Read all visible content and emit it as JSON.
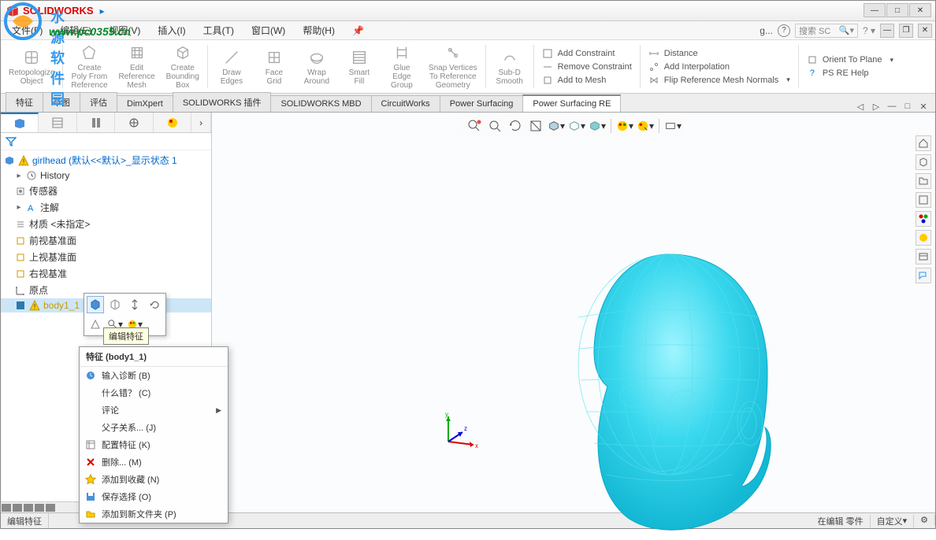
{
  "app_name": "SOLIDWORKS",
  "watermark_url": "www.pc0359.cn",
  "watermark_text": "水源软件园",
  "menus": [
    "文件(F)",
    "编辑(E)",
    "视图(V)",
    "插入(I)",
    "工具(T)",
    "窗口(W)",
    "帮助(H)"
  ],
  "search_letter": "g...",
  "search_placeholder": "搜索 SC",
  "ribbon": {
    "btns": [
      {
        "l1": "Retopologize",
        "l2": "Object"
      },
      {
        "l1": "Create",
        "l2": "Poly From",
        "l3": "Reference"
      },
      {
        "l1": "Edit",
        "l2": "Reference",
        "l3": "Mesh"
      },
      {
        "l1": "Create",
        "l2": "Bounding",
        "l3": "Box"
      },
      {
        "l1": "Draw",
        "l2": "Edges"
      },
      {
        "l1": "Face",
        "l2": "Grid"
      },
      {
        "l1": "Wrap",
        "l2": "Around"
      },
      {
        "l1": "Smart",
        "l2": "Fill"
      },
      {
        "l1": "Glue",
        "l2": "Edge",
        "l3": "Group"
      },
      {
        "l1": "Snap Vertices",
        "l2": "To Reference",
        "l3": "Geometry"
      },
      {
        "l1": "Sub-D",
        "l2": "Smooth"
      }
    ],
    "col1": [
      "Add Constraint",
      "Remove Constraint",
      "Add to Mesh"
    ],
    "col2": [
      "Distance",
      "Add Interpolation",
      "Flip Reference Mesh Normals"
    ],
    "col3": [
      "Orient To Plane",
      "PS RE Help"
    ]
  },
  "tabs": [
    "特征",
    "草图",
    "评估",
    "DimXpert",
    "SOLIDWORKS 插件",
    "SOLIDWORKS MBD",
    "CircuitWorks",
    "Power Surfacing",
    "Power Surfacing RE"
  ],
  "active_tab": "Power Surfacing RE",
  "tree": {
    "root": "girlhead (默认<<默认>_显示状态 1",
    "nodes": [
      "History",
      "传感器",
      "注解",
      "材质 <未指定>",
      "前视基准面",
      "上视基准面",
      "右视基准",
      "原点",
      "body1_1"
    ]
  },
  "tooltip": "编辑特征",
  "context_menu": {
    "title": "特征 (body1_1)",
    "items": [
      {
        "label": "输入诊断 (B)",
        "icon": "diagnose"
      },
      {
        "label": "什么错？ (C)",
        "icon": ""
      },
      {
        "label": "评论",
        "icon": "",
        "arrow": true
      },
      {
        "label": "父子关系... (J)",
        "icon": ""
      },
      {
        "label": "配置特征 (K)",
        "icon": "config"
      },
      {
        "label": "删除... (M)",
        "icon": "delete"
      },
      {
        "label": "添加到收藏 (N)",
        "icon": "star"
      },
      {
        "label": "保存选择 (O)",
        "icon": "save"
      },
      {
        "label": "添加到新文件夹 (P)",
        "icon": "folder"
      }
    ]
  },
  "status": {
    "left": "编辑特征",
    "right1": "在编辑 零件",
    "right2": "自定义"
  }
}
